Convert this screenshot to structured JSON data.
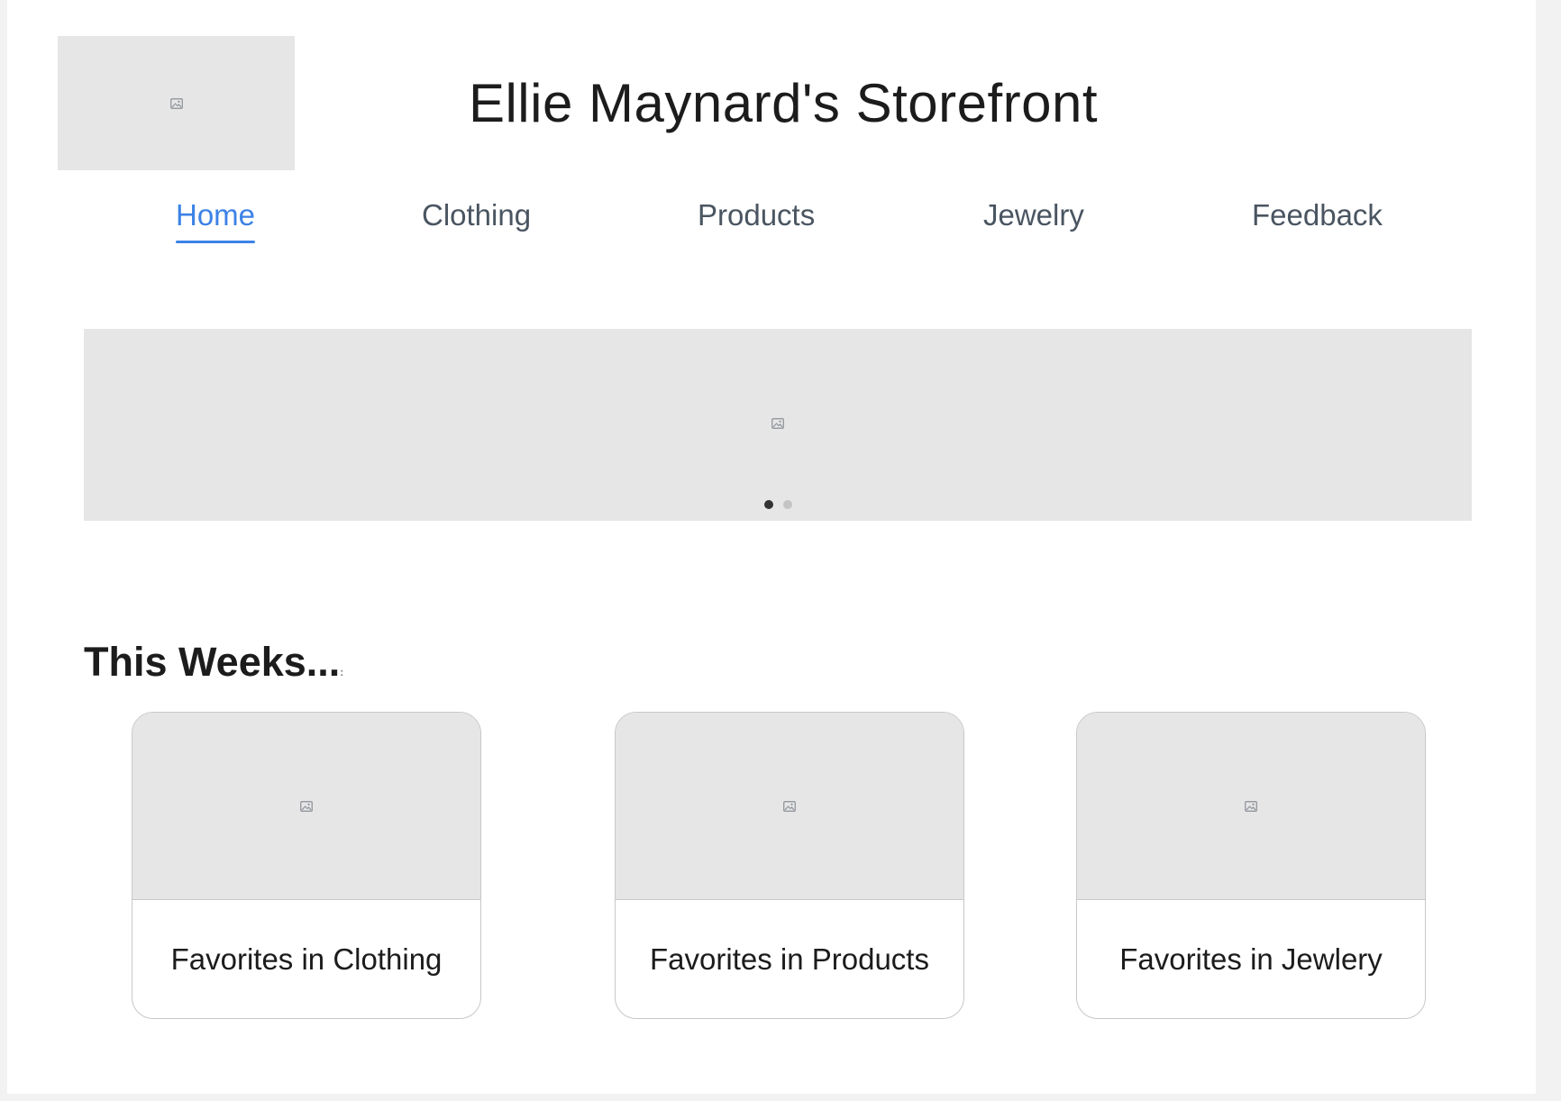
{
  "header": {
    "logo_icon": "image-placeholder-icon",
    "title": "Ellie Maynard's Storefront"
  },
  "nav": {
    "items": [
      {
        "label": "Home",
        "active": true
      },
      {
        "label": "Clothing",
        "active": false
      },
      {
        "label": "Products",
        "active": false
      },
      {
        "label": "Jewelry",
        "active": false
      },
      {
        "label": "Feedback",
        "active": false
      }
    ]
  },
  "banner": {
    "icon": "image-placeholder-icon",
    "slide_count": 2,
    "active_slide": 1
  },
  "section": {
    "heading": "This Weeks...",
    "heading_suffix": ":"
  },
  "cards": [
    {
      "label": "Favorites in Clothing",
      "icon": "image-placeholder-icon"
    },
    {
      "label": "Favorites in Products",
      "icon": "image-placeholder-icon"
    },
    {
      "label": "Favorites in Jewlery",
      "icon": "image-placeholder-icon"
    }
  ],
  "colors": {
    "accent": "#3c82e6",
    "placeholder": "#e6e6e6",
    "nav_text": "#4a5561"
  }
}
